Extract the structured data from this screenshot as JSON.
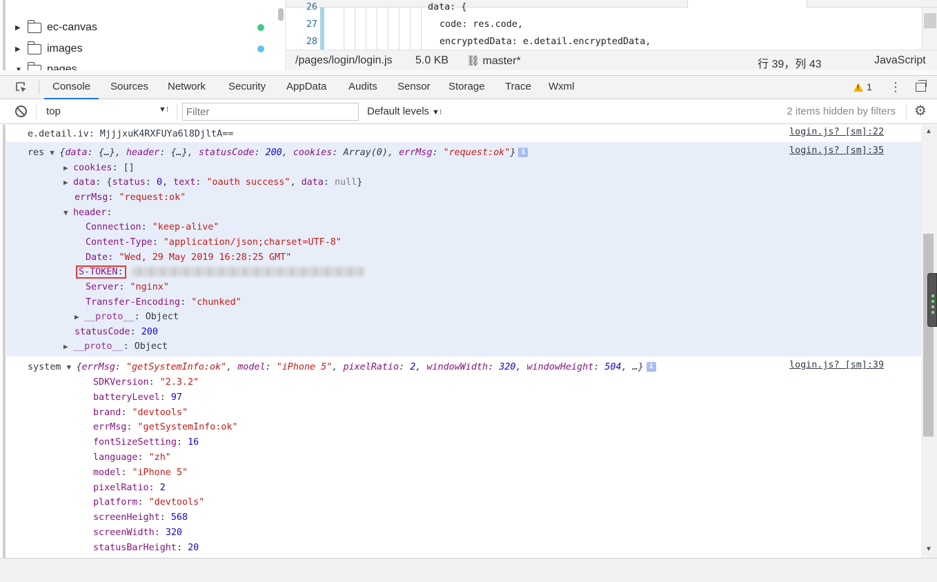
{
  "file_tree": {
    "items": [
      {
        "label": "ec-canvas",
        "dot_color": "#3ec98b"
      },
      {
        "label": "images",
        "dot_color": "#5ec1ee"
      },
      {
        "label": "pages"
      }
    ]
  },
  "editor": {
    "lines": [
      {
        "num": "26",
        "code": "data: {"
      },
      {
        "num": "27",
        "code": "code: res.code,"
      },
      {
        "num": "28",
        "code": "encryptedData: e.detail.encryptedData,"
      }
    ]
  },
  "status_bar": {
    "path": "/pages/login/login.js",
    "size": "5.0 KB",
    "branch": "master*",
    "position": "行 39，列 43",
    "language": "JavaScript"
  },
  "devtools": {
    "tabs": [
      "Console",
      "Sources",
      "Network",
      "Security",
      "AppData",
      "Audits",
      "Sensor",
      "Storage",
      "Trace",
      "Wxml"
    ],
    "active_tab": "Console",
    "warning_count": "1"
  },
  "console_toolbar": {
    "context": "top",
    "filter_placeholder": "Filter",
    "levels": "Default levels",
    "hidden_info": "2 items hidden by filters"
  },
  "console": {
    "iv": {
      "text": "e.detail.iv: MjjjxuK4RXFUYa6l8DjltA==",
      "source": "login.js? [sm]:22"
    },
    "res": {
      "label": "res",
      "summary_parts": {
        "open": "{",
        "k1": "data",
        "v1": "{…}",
        "k2": "header",
        "v2": "{…}",
        "k3": "statusCode",
        "v3": "200",
        "k4": "cookies",
        "v4": "Array(0)",
        "k5": "errMsg",
        "v5": "\"request:ok\"",
        "close": "}"
      },
      "source": "login.js? [sm]:35",
      "cookies": {
        "key": "cookies",
        "value": "[]"
      },
      "data": {
        "key": "data",
        "status_key": "status",
        "status": "0",
        "text_key": "text",
        "text": "\"oauth success\"",
        "data_key": "data",
        "data_val": "null"
      },
      "errMsg": {
        "key": "errMsg",
        "value": "\"request:ok\""
      },
      "header": {
        "key": "header",
        "connection": {
          "key": "Connection",
          "value": "\"keep-alive\""
        },
        "content_type": {
          "key": "Content-Type",
          "value": "\"application/json;charset=UTF-8\""
        },
        "date": {
          "key": "Date",
          "value": "\"Wed, 29 May 2019 16:28:25 GMT\""
        },
        "s_token": {
          "key": "S-TOKEN"
        },
        "server": {
          "key": "Server",
          "value": "\"nginx\""
        },
        "transfer_encoding": {
          "key": "Transfer-Encoding",
          "value": "\"chunked\""
        },
        "proto": {
          "key": "__proto__",
          "value": "Object"
        }
      },
      "statusCode": {
        "key": "statusCode",
        "value": "200"
      },
      "proto": {
        "key": "__proto__",
        "value": "Object"
      }
    },
    "system": {
      "label": "system",
      "summary_parts": {
        "open": "{",
        "k1": "errMsg",
        "v1": "\"getSystemInfo:ok\"",
        "k2": "model",
        "v2": "\"iPhone 5\"",
        "k3": "pixelRatio",
        "v3": "2",
        "k4": "windowWidth",
        "v4": "320",
        "k5": "windowHeight",
        "v5": "504",
        "close": ", …}"
      },
      "source": "login.js? [sm]:39",
      "props": [
        {
          "key": "SDKVersion",
          "value": "\"2.3.2\"",
          "type": "s"
        },
        {
          "key": "batteryLevel",
          "value": "97",
          "type": "n"
        },
        {
          "key": "brand",
          "value": "\"devtools\"",
          "type": "s"
        },
        {
          "key": "errMsg",
          "value": "\"getSystemInfo:ok\"",
          "type": "s"
        },
        {
          "key": "fontSizeSetting",
          "value": "16",
          "type": "n"
        },
        {
          "key": "language",
          "value": "\"zh\"",
          "type": "s"
        },
        {
          "key": "model",
          "value": "\"iPhone 5\"",
          "type": "s"
        },
        {
          "key": "pixelRatio",
          "value": "2",
          "type": "n"
        },
        {
          "key": "platform",
          "value": "\"devtools\"",
          "type": "s"
        },
        {
          "key": "screenHeight",
          "value": "568",
          "type": "n"
        },
        {
          "key": "screenWidth",
          "value": "320",
          "type": "n"
        },
        {
          "key": "statusBarHeight",
          "value": "20",
          "type": "n"
        }
      ]
    }
  }
}
